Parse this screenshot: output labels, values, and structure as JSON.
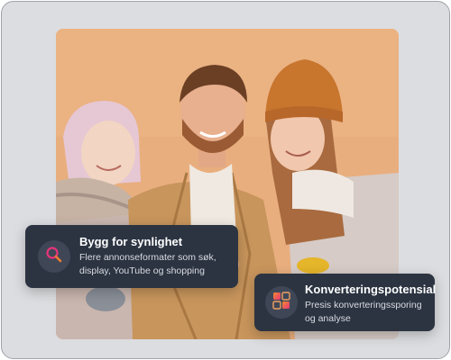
{
  "colors": {
    "frame_background": "#dcdde0",
    "photo_background": "#e8ad7c",
    "card_background": "#2c3442",
    "icon_accent": "#e8347a"
  },
  "feature_cards": [
    {
      "icon": "magnifier-search-icon",
      "title": "Bygg for synlighet",
      "description": "Flere annonseformater som søk, display, YouTube og shopping"
    },
    {
      "icon": "conversion-puzzle-icon",
      "title": "Konverteringspotensial",
      "description": "Presis konverteringssporing og analyse"
    }
  ]
}
